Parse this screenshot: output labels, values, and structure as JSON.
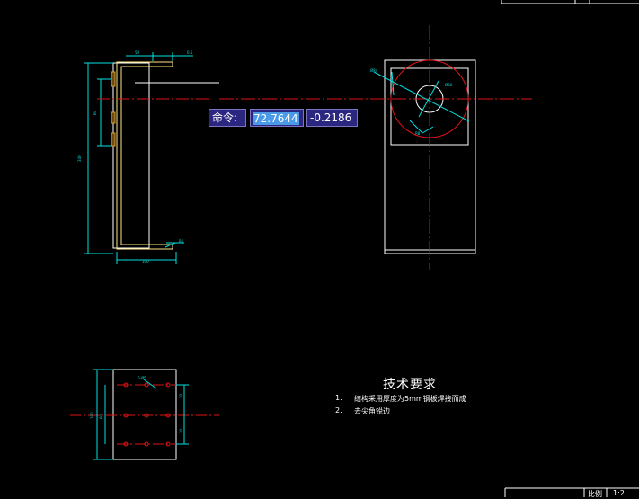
{
  "colors": {
    "background": "#000000",
    "centerline": "#e01414",
    "part": "#ffffff",
    "dimension": "#00e0e0",
    "weld": "#ffe680",
    "hatch": "#d8a030",
    "input_bg": "#2b2680",
    "input_highlight": "#4b9ae8"
  },
  "command_input": {
    "label": "命令:",
    "x_value": "72.7644",
    "y_value": "-0.2186"
  },
  "technical_requirements": {
    "title": "技术要求",
    "items": [
      {
        "num": "1.",
        "text": "结构采用厚度为5mm钢板焊接而成"
      },
      {
        "num": "2.",
        "text": "去尖角锐边"
      }
    ]
  },
  "title_block": {
    "scale_label": "比例",
    "scale_value": "1:2"
  },
  "icons": [
    "circle-hole-icon",
    "centerline-crosshair-icon"
  ]
}
